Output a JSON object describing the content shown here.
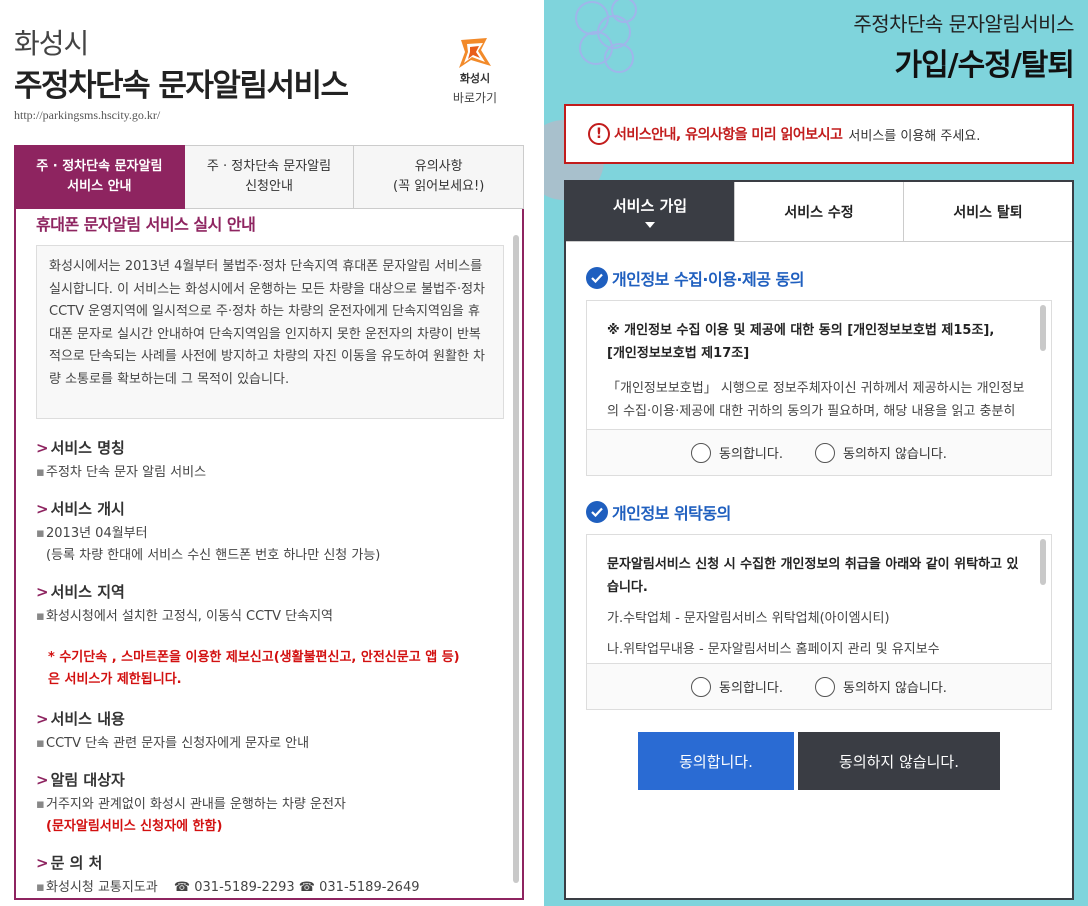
{
  "left": {
    "city": "화성시",
    "service": "주정차단속 문자알림서비스",
    "url": "http://parkingsms.hscity.go.kr/",
    "logo_name": "화성시",
    "logo_link": "바로가기",
    "tabs": [
      {
        "line1": "주 · 정차단속 문자알림",
        "line2": "서비스 안내"
      },
      {
        "line1": "주 · 정차단속 문자알림",
        "line2": "신청안내"
      },
      {
        "line1": "유의사항",
        "line2": "(꼭 읽어보세요!)"
      }
    ],
    "heading": "휴대폰 문자알림 서비스 실시 안내",
    "intro": "화성시에서는 2013년 4월부터 불법주·정차 단속지역 휴대폰 문자알림 서비스를 실시합니다. 이 서비스는 화성시에서 운행하는 모든 차량을 대상으로 불법주·정차 CCTV 운영지역에 일시적으로 주·정차 하는 차량의 운전자에게 단속지역임을 휴대폰 문자로 실시간 안내하여 단속지역임을 인지하지 못한 운전자의 차량이 반복적으로 단속되는 사례를 사전에 방지하고 차량의 자진 이동을 유도하여 원활한 차량 소통로를 확보하는데 그 목적이 있습니다.",
    "sections": {
      "name_title": "서비스 명칭",
      "name_body": "주정차 단속 문자 알림 서비스",
      "start_title": "서비스 개시",
      "start_body1": "2013년 04월부터",
      "start_body2": "(등록 차량 한대에 서비스 수신 핸드폰 번호 하나만 신청 가능)",
      "area_title": "서비스 지역",
      "area_body": "화성시청에서 설치한 고정식, 이동식 CCTV 단속지역",
      "warn1": "* 수기단속 , 스마트폰을 이용한 제보신고(생활불편신고, 안전신문고 앱 등)",
      "warn2": "은 서비스가 제한됩니다.",
      "content_title": "서비스 내용",
      "content_body": "CCTV 단속 관련 문자를 신청자에게 문자로 안내",
      "target_title": "알림 대상자",
      "target_body": "거주지와 관계없이 화성시 관내를 운행하는 차량 운전자",
      "target_red": "(문자알림서비스 신청자에 한함)",
      "contact_title": "문 의 처",
      "contact_org": "화성시청 교통지도과",
      "phone1": "031-5189-2293",
      "phone2": "031-5189-2649"
    }
  },
  "right": {
    "subtitle": "주정차단속 문자알림서비스",
    "title": "가입/수정/탈퇴",
    "notice_strong": "서비스안내, 유의사항을 미리 읽어보시고",
    "notice_rest": "서비스를 이용해 주세요.",
    "tabs": [
      "서비스 가입",
      "서비스 수정",
      "서비스 탈퇴"
    ],
    "privacy": {
      "title": "개인정보 수집·이용·제공 동의",
      "bold1": "※ 개인정보 수집 이용 및 제공에 대한 동의 [개인정보보호법 제15조],",
      "bold2": "[개인정보보호법 제17조]",
      "text": "「개인정보보호법」 시행으로 정보주체자이신 귀하께서 제공하시는 개인정보의 수집·이용·제공에 대한 귀하의 동의가 필요하며, 해당 내용을 읽고 충분히 숙지하시고 서비스 신청서에 동의 여부 주시기 바랍니다."
    },
    "consign": {
      "title": "개인정보 위탁동의",
      "bold": "문자알림서비스 신청 시 수집한 개인정보의 취급을 아래와 같이 위탁하고 있습니다.",
      "line1": "가.수탁업체 - 문자알림서비스 위탁업체(아이엠시티)",
      "line2": "나.위탁업무내용 - 문자알림서비스 홈페이지 관리 및 유지보수"
    },
    "agree": "동의합니다.",
    "disagree": "동의하지 않습니다.",
    "btn_agree": "동의합니다.",
    "btn_disagree": "동의하지 않습니다."
  },
  "colors": {
    "left_accent": "#8e2460",
    "right_bg": "#7fd4dc",
    "notice_red": "#c21c1c",
    "tab_dark": "#3a3d44",
    "agree_blue": "#2a6bd3",
    "heading_blue": "#1f5fbf"
  }
}
